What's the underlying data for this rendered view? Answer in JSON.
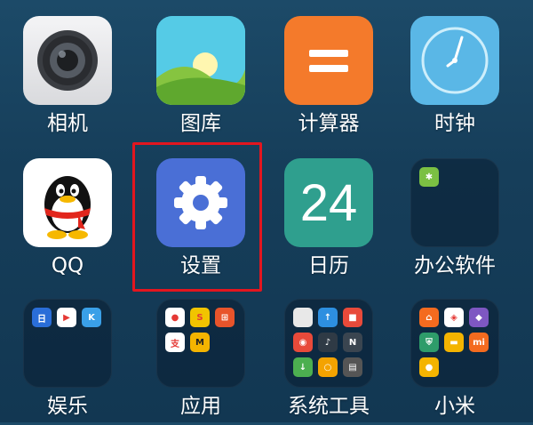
{
  "apps": [
    {
      "key": "camera",
      "label": "相机",
      "icon": "camera-icon"
    },
    {
      "key": "gallery",
      "label": "图库",
      "icon": "gallery-icon"
    },
    {
      "key": "calculator",
      "label": "计算器",
      "icon": "calculator-icon"
    },
    {
      "key": "clock",
      "label": "时钟",
      "icon": "clock-icon"
    },
    {
      "key": "qq",
      "label": "QQ",
      "icon": "qq-penguin-icon"
    },
    {
      "key": "settings",
      "label": "设置",
      "icon": "settings-gear-icon"
    },
    {
      "key": "calendar",
      "label": "日历",
      "icon": "calendar-icon",
      "day": "24"
    },
    {
      "key": "office",
      "label": "办公软件",
      "icon": "folder-icon"
    },
    {
      "key": "entertainment",
      "label": "娱乐",
      "icon": "folder-icon"
    },
    {
      "key": "apps",
      "label": "应用",
      "icon": "folder-icon"
    },
    {
      "key": "system_tools",
      "label": "系统工具",
      "icon": "folder-icon"
    },
    {
      "key": "xiaomi",
      "label": "小米",
      "icon": "folder-icon"
    }
  ],
  "colors": {
    "highlight_border": "#e3161f",
    "settings_bg": "#4a6fd6",
    "calculator_bg": "#f47a2b",
    "clock_bg": "#5ab7e6",
    "calendar_bg": "#2f9f8e"
  }
}
